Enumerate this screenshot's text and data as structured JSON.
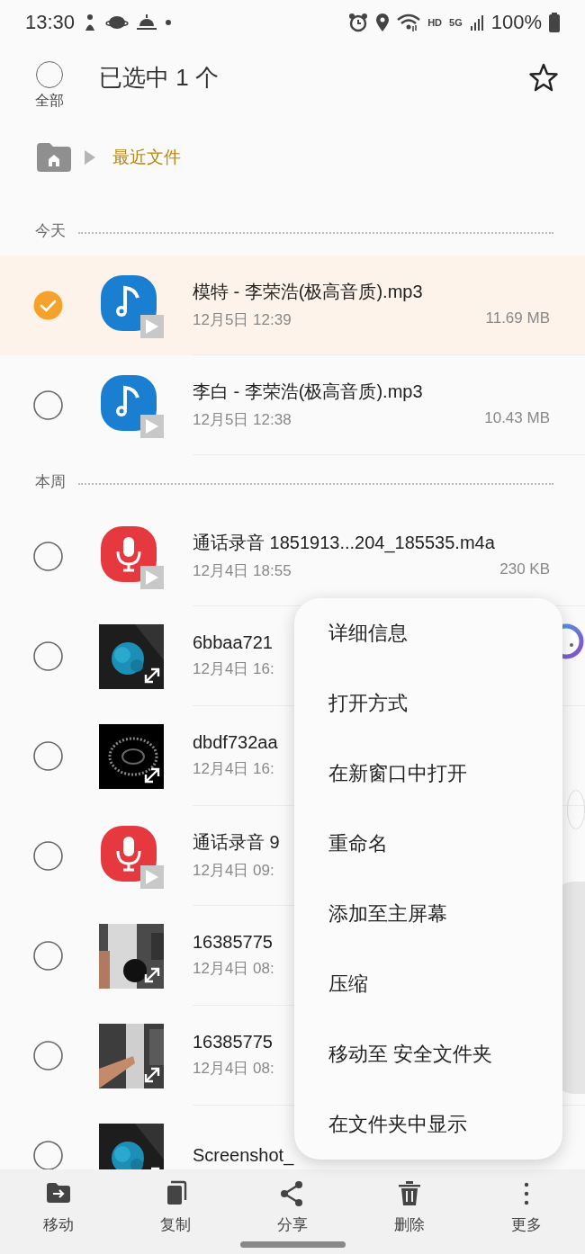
{
  "status_bar": {
    "time": "13:30",
    "network": "HD",
    "generation": "5G",
    "battery": "100%"
  },
  "header": {
    "select_all_label": "全部",
    "select_all_checked": false,
    "title": "已选中 1 个"
  },
  "breadcrumb": {
    "path": "最近文件"
  },
  "sections": [
    {
      "label": "今天",
      "files": [
        {
          "kind": "audio",
          "name": "模特 - 李荣浩(极高音质).mp3",
          "date": "12月5日 12:39",
          "size": "11.69 MB",
          "selected": true
        },
        {
          "kind": "audio",
          "name": "李白 - 李荣浩(极高音质).mp3",
          "date": "12月5日 12:38",
          "size": "10.43 MB",
          "selected": false
        }
      ]
    },
    {
      "label": "本周",
      "files": [
        {
          "kind": "recording",
          "name": "通话录音 1851913...204_185535.m4a",
          "date": "12月4日 18:55",
          "size": "230 KB",
          "selected": false
        },
        {
          "name": "6bbaa721",
          "date": "12月4日 16:",
          "selected": false
        },
        {
          "name": "dbdf732aa",
          "date": "12月4日 16:",
          "selected": false
        },
        {
          "kind": "recording",
          "name": "通话录音 9",
          "date": "12月4日 09:",
          "selected": false
        },
        {
          "name": "16385775",
          "date": "12月4日 08:",
          "selected": false
        },
        {
          "name": "16385775",
          "date": "12月4日 08:",
          "selected": false
        },
        {
          "name": "Screenshot_",
          "selected": false
        }
      ]
    }
  ],
  "context_menu": {
    "items": [
      "详细信息",
      "打开方式",
      "在新窗口中打开",
      "重命名",
      "添加至主屏幕",
      "压缩",
      "移动至 安全文件夹",
      "在文件夹中显示"
    ]
  },
  "bottom_bar": {
    "actions": [
      {
        "kind": "move",
        "label": "移动"
      },
      {
        "kind": "copy",
        "label": "复制"
      },
      {
        "kind": "share",
        "label": "分享"
      },
      {
        "kind": "delete",
        "label": "删除"
      },
      {
        "kind": "more",
        "label": "更多"
      }
    ]
  }
}
